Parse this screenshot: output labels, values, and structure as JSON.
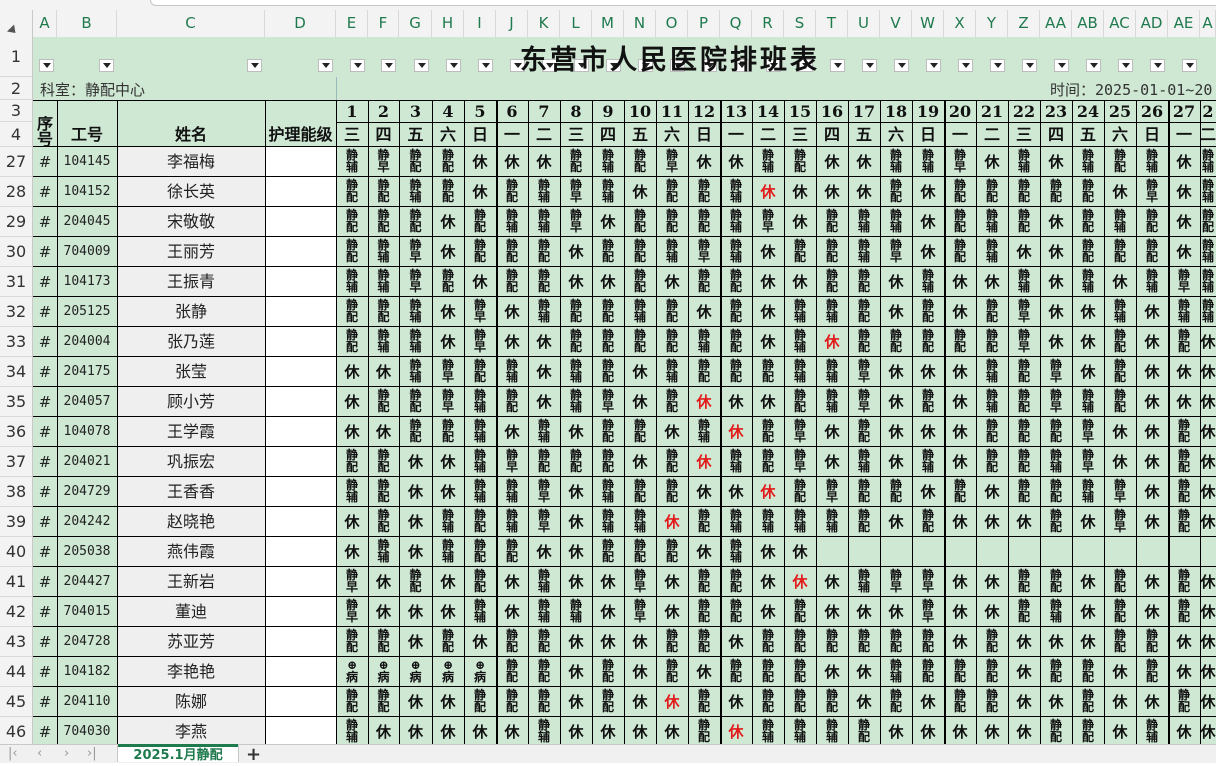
{
  "sheet": {
    "title": "东营市人民医院排班表",
    "dept_label": "科室：静配中心",
    "time_label": "时间：2025-01-01~20",
    "tab_name": "2025.1月静配",
    "add_tab": "+"
  },
  "columns": [
    "A",
    "B",
    "C",
    "D",
    "E",
    "F",
    "G",
    "H",
    "I",
    "J",
    "K",
    "L",
    "M",
    "N",
    "O",
    "P",
    "Q",
    "R",
    "S",
    "T",
    "U",
    "V",
    "W",
    "X",
    "Y",
    "Z",
    "AA",
    "AB",
    "AC",
    "AD",
    "AE",
    "A"
  ],
  "row_numbers_top": [
    "1",
    "2",
    "3",
    "4"
  ],
  "header": {
    "seq": "序号",
    "id": "工号",
    "name": "姓名",
    "skill": "护理能级"
  },
  "days": [
    "1",
    "2",
    "3",
    "4",
    "5",
    "6",
    "7",
    "8",
    "9",
    "10",
    "11",
    "12",
    "13",
    "14",
    "15",
    "16",
    "17",
    "18",
    "19",
    "20",
    "21",
    "22",
    "23",
    "24",
    "25",
    "26",
    "27",
    "2"
  ],
  "weekdays": [
    "三",
    "四",
    "五",
    "六",
    "日",
    "一",
    "二",
    "三",
    "四",
    "五",
    "六",
    "日",
    "一",
    "二",
    "三",
    "四",
    "五",
    "六",
    "日",
    "一",
    "二",
    "三",
    "四",
    "五",
    "六",
    "日",
    "一",
    "二"
  ],
  "shift_codes": {
    "jp": [
      "静",
      "配"
    ],
    "jf": [
      "静",
      "辅"
    ],
    "jz": [
      "静",
      "早"
    ],
    "x": [
      "休"
    ],
    "bing": [
      "⊕",
      "病"
    ]
  },
  "rows": [
    {
      "rn": "27",
      "seq": "#",
      "id": "104145",
      "name": "李福梅",
      "s": [
        "jf",
        "jz",
        "jp",
        "jp",
        "x",
        "x",
        "x",
        "jp",
        "jf",
        "jp",
        "jz",
        "x",
        "x",
        "jf",
        "jp",
        "x",
        "x",
        "jf",
        "jf",
        "jz",
        "x",
        "jf",
        "x",
        "jf",
        "jp",
        "jf",
        "x",
        "jf"
      ],
      "red": []
    },
    {
      "rn": "28",
      "seq": "#",
      "id": "104152",
      "name": "徐长英",
      "s": [
        "jp",
        "jp",
        "jf",
        "jp",
        "x",
        "jp",
        "jf",
        "jz",
        "jf",
        "x",
        "jp",
        "jp",
        "jf",
        "x",
        "x",
        "x",
        "x",
        "jp",
        "x",
        "jp",
        "jp",
        "jp",
        "jp",
        "jp",
        "x",
        "jz",
        "x",
        "jf"
      ],
      "red": [
        13
      ]
    },
    {
      "rn": "29",
      "seq": "#",
      "id": "204045",
      "name": "宋敬敬",
      "s": [
        "jp",
        "jp",
        "jp",
        "x",
        "jp",
        "jf",
        "jf",
        "jz",
        "x",
        "jp",
        "jp",
        "jp",
        "jf",
        "jz",
        "x",
        "jp",
        "jf",
        "jf",
        "x",
        "jp",
        "jf",
        "jp",
        "x",
        "jp",
        "jf",
        "jp",
        "x",
        "jp"
      ],
      "red": []
    },
    {
      "rn": "30",
      "seq": "#",
      "id": "704009",
      "name": "王丽芳",
      "s": [
        "jp",
        "jf",
        "jz",
        "x",
        "jp",
        "jp",
        "jp",
        "x",
        "jp",
        "jp",
        "jf",
        "jz",
        "jf",
        "x",
        "jp",
        "jp",
        "jf",
        "jz",
        "x",
        "jp",
        "jf",
        "x",
        "x",
        "jp",
        "jp",
        "jp",
        "x",
        "jf"
      ],
      "red": []
    },
    {
      "rn": "31",
      "seq": "#",
      "id": "104173",
      "name": "王振青",
      "s": [
        "jf",
        "jf",
        "jz",
        "jp",
        "x",
        "jp",
        "jp",
        "x",
        "x",
        "jp",
        "x",
        "jp",
        "jp",
        "x",
        "x",
        "jp",
        "jp",
        "x",
        "jf",
        "x",
        "x",
        "jf",
        "x",
        "jf",
        "x",
        "jf",
        "jz",
        "jf"
      ],
      "red": []
    },
    {
      "rn": "32",
      "seq": "#",
      "id": "205125",
      "name": "张静",
      "s": [
        "jp",
        "jp",
        "jf",
        "x",
        "jz",
        "x",
        "jf",
        "jp",
        "jp",
        "jf",
        "jp",
        "x",
        "jp",
        "x",
        "jf",
        "jf",
        "jp",
        "x",
        "jp",
        "x",
        "jp",
        "jz",
        "x",
        "x",
        "jf",
        "x",
        "jf",
        "jf"
      ],
      "red": []
    },
    {
      "rn": "33",
      "seq": "#",
      "id": "204004",
      "name": "张乃莲",
      "s": [
        "jp",
        "jf",
        "jf",
        "x",
        "jz",
        "x",
        "x",
        "jp",
        "jp",
        "jp",
        "jp",
        "jf",
        "jp",
        "x",
        "jf",
        "x",
        "jp",
        "jp",
        "jp",
        "jp",
        "jp",
        "jz",
        "x",
        "x",
        "jp",
        "x",
        "jp",
        "x"
      ],
      "red": [
        15
      ]
    },
    {
      "rn": "34",
      "seq": "#",
      "id": "204175",
      "name": "张莹",
      "s": [
        "x",
        "x",
        "jf",
        "jz",
        "jp",
        "jf",
        "x",
        "jf",
        "jp",
        "x",
        "jf",
        "jp",
        "jp",
        "jp",
        "jf",
        "jf",
        "jz",
        "x",
        "x",
        "x",
        "jf",
        "jp",
        "jz",
        "x",
        "jp",
        "x",
        "x",
        "x"
      ],
      "red": []
    },
    {
      "rn": "35",
      "seq": "#",
      "id": "204057",
      "name": "顾小芳",
      "s": [
        "x",
        "jp",
        "jp",
        "jz",
        "jf",
        "jp",
        "x",
        "jf",
        "jz",
        "x",
        "jp",
        "x",
        "x",
        "x",
        "jp",
        "jf",
        "jz",
        "x",
        "jp",
        "x",
        "jf",
        "jp",
        "jz",
        "jf",
        "jp",
        "x",
        "x",
        "x"
      ],
      "red": [
        11
      ]
    },
    {
      "rn": "36",
      "seq": "#",
      "id": "104078",
      "name": "王学霞",
      "s": [
        "x",
        "x",
        "jp",
        "jp",
        "jf",
        "x",
        "jf",
        "x",
        "jp",
        "jp",
        "x",
        "jf",
        "x",
        "jp",
        "jz",
        "x",
        "jp",
        "x",
        "x",
        "x",
        "jp",
        "jp",
        "jp",
        "jz",
        "x",
        "x",
        "jp",
        "x"
      ],
      "red": [
        12
      ]
    },
    {
      "rn": "37",
      "seq": "#",
      "id": "204021",
      "name": "巩振宏",
      "s": [
        "jp",
        "jp",
        "x",
        "x",
        "jf",
        "jz",
        "jp",
        "jp",
        "jp",
        "x",
        "jp",
        "x",
        "jf",
        "jp",
        "jz",
        "x",
        "jf",
        "x",
        "jf",
        "x",
        "jp",
        "jp",
        "jf",
        "jz",
        "x",
        "x",
        "jp",
        "x"
      ],
      "red": [
        11
      ]
    },
    {
      "rn": "38",
      "seq": "#",
      "id": "204729",
      "name": "王香香",
      "s": [
        "jf",
        "jp",
        "x",
        "x",
        "jf",
        "jf",
        "jz",
        "x",
        "jf",
        "jp",
        "jp",
        "x",
        "x",
        "x",
        "jp",
        "jz",
        "jp",
        "jp",
        "x",
        "jp",
        "x",
        "jp",
        "jp",
        "jf",
        "jz",
        "x",
        "jp",
        "x"
      ],
      "red": [
        13
      ]
    },
    {
      "rn": "39",
      "seq": "#",
      "id": "204242",
      "name": "赵晓艳",
      "s": [
        "x",
        "jp",
        "x",
        "jf",
        "jp",
        "jf",
        "jz",
        "x",
        "jf",
        "jf",
        "x",
        "jp",
        "jf",
        "jf",
        "jf",
        "jf",
        "jp",
        "x",
        "jp",
        "x",
        "x",
        "x",
        "jp",
        "x",
        "jz",
        "x",
        "jp",
        "x"
      ],
      "red": [
        10
      ]
    },
    {
      "rn": "40",
      "seq": "#",
      "id": "205038",
      "name": "燕伟霞",
      "s": [
        "x",
        "jf",
        "x",
        "jf",
        "jp",
        "jp",
        "x",
        "x",
        "jp",
        "jp",
        "jp",
        "x",
        "jf",
        "x",
        "x",
        "",
        "",
        "",
        "",
        "",
        "",
        "",
        "",
        "",
        "",
        "",
        "",
        ""
      ],
      "red": []
    },
    {
      "rn": "41",
      "seq": "#",
      "id": "204427",
      "name": "王新岩",
      "s": [
        "jz",
        "x",
        "jp",
        "x",
        "jp",
        "x",
        "jf",
        "x",
        "x",
        "jz",
        "x",
        "jp",
        "jp",
        "x",
        "x",
        "x",
        "jf",
        "jz",
        "jz",
        "x",
        "x",
        "jp",
        "jp",
        "x",
        "jp",
        "x",
        "jp",
        "x"
      ],
      "red": [
        14
      ]
    },
    {
      "rn": "42",
      "seq": "#",
      "id": "704015",
      "name": "董迪",
      "s": [
        "jz",
        "x",
        "x",
        "x",
        "jf",
        "x",
        "jf",
        "jf",
        "x",
        "jz",
        "x",
        "jp",
        "jp",
        "x",
        "jp",
        "x",
        "x",
        "x",
        "jz",
        "x",
        "x",
        "jp",
        "jf",
        "x",
        "jp",
        "x",
        "jp",
        "x"
      ],
      "red": []
    },
    {
      "rn": "43",
      "seq": "#",
      "id": "204728",
      "name": "苏亚芳",
      "s": [
        "jp",
        "jp",
        "x",
        "jp",
        "x",
        "jp",
        "jp",
        "x",
        "x",
        "x",
        "jp",
        "jp",
        "x",
        "jp",
        "jp",
        "jp",
        "jp",
        "jp",
        "jp",
        "x",
        "jp",
        "x",
        "x",
        "x",
        "jp",
        "jp",
        "x",
        "x"
      ],
      "red": []
    },
    {
      "rn": "44",
      "seq": "#",
      "id": "104182",
      "name": "李艳艳",
      "s": [
        "bing",
        "bing",
        "bing",
        "bing",
        "bing",
        "jp",
        "jp",
        "x",
        "jp",
        "x",
        "jp",
        "x",
        "jp",
        "jp",
        "jp",
        "x",
        "x",
        "jf",
        "jp",
        "jp",
        "jp",
        "x",
        "jp",
        "jp",
        "x",
        "jp",
        "x",
        "x"
      ],
      "red": []
    },
    {
      "rn": "45",
      "seq": "#",
      "id": "204110",
      "name": "陈娜",
      "s": [
        "jp",
        "jp",
        "x",
        "x",
        "jp",
        "jp",
        "jp",
        "x",
        "jp",
        "x",
        "x",
        "jp",
        "x",
        "jp",
        "jp",
        "jp",
        "x",
        "jp",
        "x",
        "jp",
        "jp",
        "x",
        "x",
        "jp",
        "x",
        "x",
        "jp",
        "x"
      ],
      "red": [
        10
      ]
    },
    {
      "rn": "46",
      "seq": "#",
      "id": "704030",
      "name": "李燕",
      "s": [
        "jf",
        "x",
        "x",
        "x",
        "x",
        "x",
        "jf",
        "x",
        "x",
        "x",
        "x",
        "jp",
        "x",
        "jf",
        "jf",
        "jf",
        "jp",
        "x",
        "x",
        "x",
        "x",
        "x",
        "jp",
        "jp",
        "x",
        "jf",
        "x",
        "x"
      ],
      "red": [
        12
      ]
    }
  ]
}
